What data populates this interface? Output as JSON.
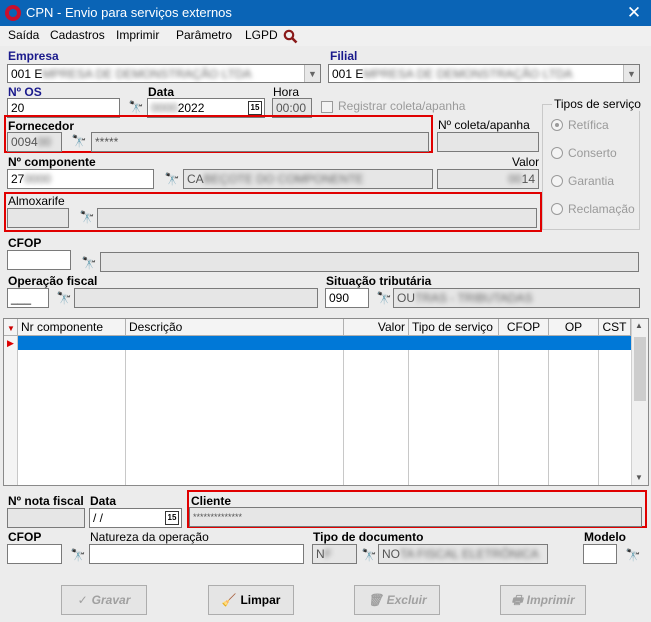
{
  "window": {
    "title": "CPN - Envio para serviços externos",
    "close_icon": "close-icon"
  },
  "menu": [
    "Saída",
    "Cadastros",
    "Imprimir",
    "Parâmetro",
    "LGPD"
  ],
  "empresa": {
    "label": "Empresa",
    "value": "001 E"
  },
  "filial": {
    "label": "Filial",
    "value": "001 E"
  },
  "os": {
    "label": "Nº  OS",
    "value": "20"
  },
  "data": {
    "label": "Data",
    "value": "2022"
  },
  "hora": {
    "label": "Hora",
    "value": "00:00"
  },
  "registrar": {
    "label": "Registrar coleta/apanha"
  },
  "tipos_servico": {
    "label": "Tipos de serviço",
    "options": [
      "Retífica",
      "Conserto",
      "Garantia",
      "Reclamação"
    ],
    "selected": "Retífica"
  },
  "fornecedor": {
    "label": "Fornecedor",
    "code": "0094",
    "name": "*****"
  },
  "coleta": {
    "label": "Nº coleta/apanha",
    "value": ""
  },
  "componente": {
    "label": "Nº  componente",
    "code": "27",
    "description": "CA"
  },
  "valor": {
    "label": "Valor",
    "value": "14"
  },
  "almoxarife": {
    "label": "Almoxarife",
    "code": "",
    "name": ""
  },
  "cfop": {
    "label": "CFOP",
    "value": ""
  },
  "operacao_fiscal": {
    "label": "Operação fiscal",
    "value": "___"
  },
  "situacao_tributaria": {
    "label": "Situação tributária",
    "code": "090",
    "description": "OU"
  },
  "grid": {
    "columns": [
      "Nr componente",
      "Descrição",
      "Valor",
      "Tipo de serviço",
      "CFOP",
      "OP",
      "CST"
    ],
    "rows": []
  },
  "nota_fiscal": {
    "label": "Nº nota fiscal",
    "value": ""
  },
  "data_nf": {
    "label": "Data",
    "value": " /  /"
  },
  "cliente": {
    "label": "Cliente",
    "value": "**************"
  },
  "cfop2": {
    "label": "CFOP",
    "value": ""
  },
  "natureza": {
    "label": "Natureza da operação",
    "value": ""
  },
  "tipo_documento": {
    "label": "Tipo de documento",
    "code": "N",
    "description": "NO"
  },
  "modelo": {
    "label": "Modelo",
    "value": ""
  },
  "buttons": {
    "gravar": "Gravar",
    "limpar": "Limpar",
    "excluir": "Excluir",
    "imprimir": "Imprimir"
  },
  "calendar_icon_text": "15",
  "colors": {
    "titlebar": "#0a64b6",
    "highlight": "#e00000",
    "selection": "#0078d7"
  }
}
